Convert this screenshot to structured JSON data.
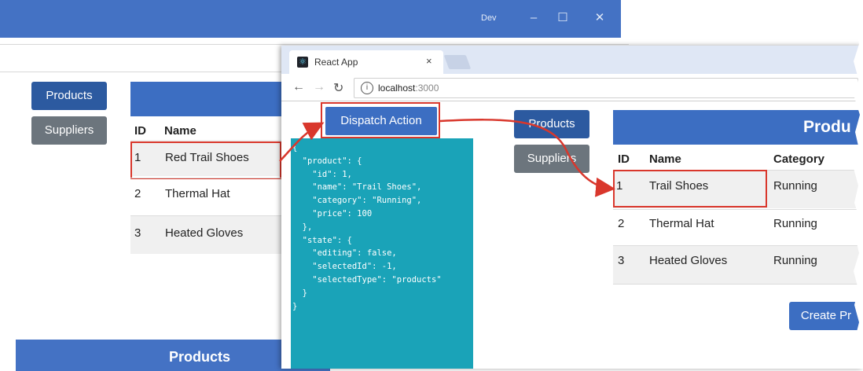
{
  "back_window": {
    "title": "Dev",
    "controls": [
      "–",
      "☐",
      "✕"
    ],
    "nav": {
      "products": "Products",
      "suppliers": "Suppliers"
    },
    "table": {
      "headers": [
        "ID",
        "Name"
      ],
      "rows": [
        {
          "id": "1",
          "name": "Red Trail Shoes"
        },
        {
          "id": "2",
          "name": "Thermal Hat"
        },
        {
          "id": "3",
          "name": "Heated Gloves"
        }
      ]
    },
    "footer_title": "Products"
  },
  "front_window": {
    "tab_title": "React App",
    "tab_close": "×",
    "url_host": "localhost",
    "url_port": ":3000",
    "dispatch_button": "Dispatch Action",
    "json_lines": [
      "{",
      "  \"product\": {",
      "    \"id\": 1,",
      "    \"name\": \"Trail Shoes\",",
      "    \"category\": \"Running\",",
      "    \"price\": 100",
      "  },",
      "  \"state\": {",
      "    \"editing\": false,",
      "    \"selectedId\": -1,",
      "    \"selectedType\": \"products\"",
      "  }",
      "}"
    ],
    "nav": {
      "products": "Products",
      "suppliers": "Suppliers"
    },
    "table": {
      "title": "Produ",
      "headers": [
        "ID",
        "Name",
        "Category"
      ],
      "rows": [
        {
          "id": "1",
          "name": "Trail Shoes",
          "category": "Running"
        },
        {
          "id": "2",
          "name": "Thermal Hat",
          "category": "Running"
        },
        {
          "id": "3",
          "name": "Heated Gloves",
          "category": "Running"
        }
      ]
    },
    "create_button": "Create Pr"
  },
  "colors": {
    "titlebar": "#4472c4",
    "primary_button": "#3c6ec2",
    "secondary_button": "#6c757d",
    "json_panel": "#1aa3b8",
    "highlight": "#d9372c"
  }
}
